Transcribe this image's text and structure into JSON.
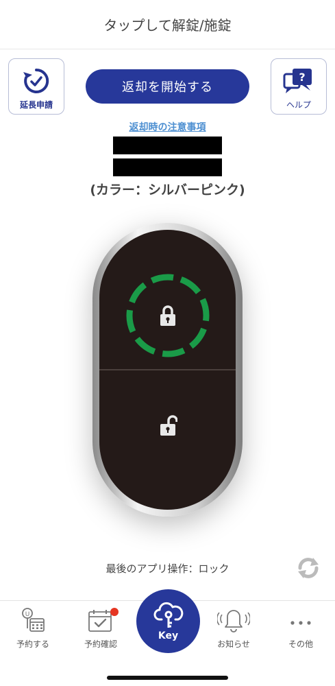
{
  "header": {
    "title": "タップして解錠/施錠"
  },
  "actions": {
    "extension_label": "延長申請",
    "return_label": "返却を開始する",
    "help_label": "ヘルプ"
  },
  "notes_link": "返却時の注意事項",
  "color_note": "(カラー：シルバーピンク)",
  "lock": {
    "state": "locked",
    "ring_color": "#1a9b48"
  },
  "last_operation": "最後のアプリ操作：ロック",
  "tabs": [
    {
      "label": "予約する",
      "icon": "calendar-user-icon"
    },
    {
      "label": "予約確認",
      "icon": "calendar-check-icon",
      "badge": true
    },
    {
      "label": "Key",
      "icon": "cloud-key-icon"
    },
    {
      "label": "お知らせ",
      "icon": "bell-icon"
    },
    {
      "label": "その他",
      "icon": "more-icon"
    }
  ],
  "colors": {
    "brand": "#27389a",
    "link": "#4d8fd1",
    "badge": "#e53522"
  }
}
